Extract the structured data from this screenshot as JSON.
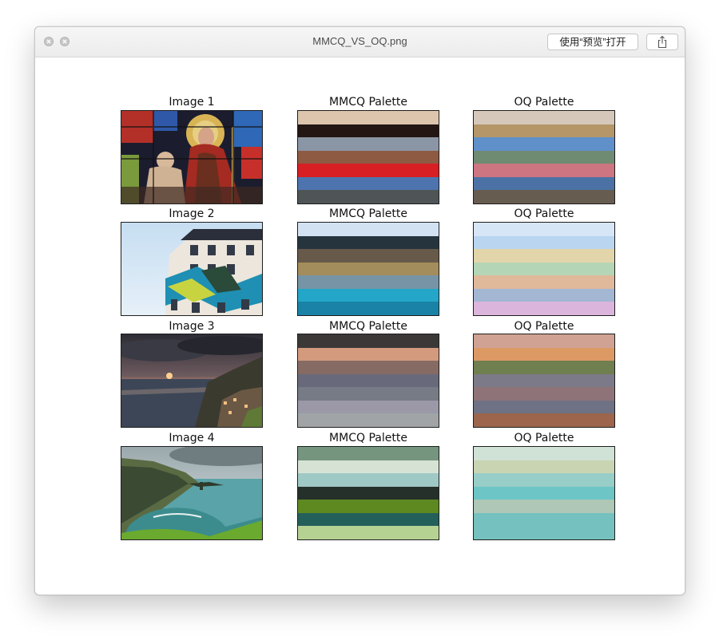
{
  "window": {
    "title": "MMCQ_VS_OQ.png",
    "open_button_label": "使用“预览”打开"
  },
  "icons": {
    "close": "close-icon",
    "minimize": "minimize-icon",
    "share": "share-icon"
  },
  "figure": {
    "rows": [
      {
        "image_label": "Image 1",
        "mmcq_label": "MMCQ Palette",
        "oq_label": "OQ Palette",
        "mmcq": [
          "#dcc4ad",
          "#241613",
          "#8a96a5",
          "#8e5a42",
          "#d81f24",
          "#4d74ae",
          "#4f5557"
        ],
        "oq": [
          "#d5c8ba",
          "#b49669",
          "#5f90c9",
          "#6f8b72",
          "#cd7581",
          "#4c72a5",
          "#675c50"
        ]
      },
      {
        "image_label": "Image 2",
        "mmcq_label": "MMCQ Palette",
        "oq_label": "OQ Palette",
        "mmcq": [
          "#d2e2f2",
          "#26343e",
          "#675a4a",
          "#a48d5c",
          "#7694a5",
          "#23a6c8",
          "#1a82a6"
        ],
        "oq": [
          "#d7e6f6",
          "#b9d5f0",
          "#e3d5aa",
          "#b4d6b6",
          "#e0b89a",
          "#a3b7d3",
          "#dcb5dc"
        ]
      },
      {
        "image_label": "Image 3",
        "mmcq_label": "MMCQ Palette",
        "oq_label": "OQ Palette",
        "mmcq": [
          "#3c3838",
          "#d49a7d",
          "#866b64",
          "#686a7b",
          "#767b86",
          "#9b99a8",
          "#a0a4a6"
        ],
        "oq": [
          "#cfa293",
          "#dd9963",
          "#6f7f4f",
          "#7c7a88",
          "#8e7478",
          "#6f7185",
          "#9c654c"
        ]
      },
      {
        "image_label": "Image 4",
        "mmcq_label": "MMCQ Palette",
        "oq_label": "OQ Palette",
        "mmcq": [
          "#75957f",
          "#d6e3d4",
          "#9fc9c5",
          "#26302a",
          "#5e8921",
          "#24605a",
          "#b6d293"
        ],
        "oq": [
          "#d0e1d6",
          "#c9d4b2",
          "#98cec8",
          "#6dc5c6",
          "#aec7b7",
          "#74c1bf",
          "#74c1bf"
        ]
      }
    ]
  }
}
